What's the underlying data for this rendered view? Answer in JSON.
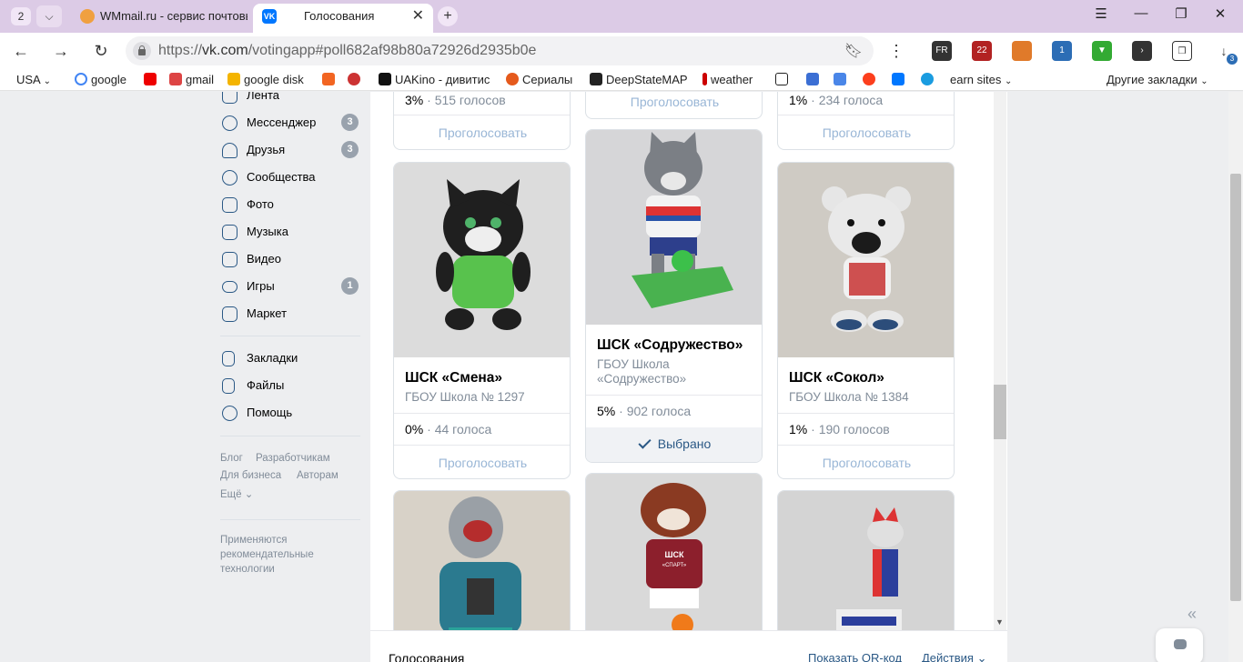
{
  "browser": {
    "tab_count": "2",
    "tabs": [
      {
        "title": "WMmail.ru - сервис почтовых",
        "active": false
      },
      {
        "title": "Голосования",
        "active": true
      }
    ],
    "url_prefix": "https://",
    "url_host": "vk.com",
    "url_path": "/votingapp#poll682af98b80a72926d2935b0e",
    "extensions": [
      {
        "icon": "globe-icon",
        "badge": "FR",
        "color": "#333333"
      },
      {
        "icon": "shield-icon",
        "badge": "22",
        "color": "#b22222"
      },
      {
        "icon": "briefcase-icon",
        "badge": "",
        "color": "#e07a2a"
      },
      {
        "icon": "puzzle-icon",
        "badge": "1",
        "color": "#2c6db5"
      },
      {
        "icon": "download-arrow-icon",
        "badge": "",
        "color": "#33aa33"
      },
      {
        "icon": "terminal-icon",
        "badge": "",
        "color": "#333333"
      },
      {
        "icon": "collections-icon",
        "badge": "",
        "color": "#333333"
      },
      {
        "icon": "downloads-icon",
        "badge": "3",
        "color": "#2c6db5"
      }
    ]
  },
  "bookmarks": [
    {
      "label": "USA",
      "icon": "chevron-down-icon"
    },
    {
      "label": "google",
      "icon": "google-icon"
    },
    {
      "label": "",
      "icon": "youtube-icon"
    },
    {
      "label": "gmail",
      "icon": "gmail-icon"
    },
    {
      "label": "google disk",
      "icon": "drive-icon"
    },
    {
      "label": "",
      "icon": "f-icon"
    },
    {
      "label": "",
      "icon": "flower-icon"
    },
    {
      "label": "UAKino - дивитис",
      "icon": "uakino-icon"
    },
    {
      "label": "Сериалы",
      "icon": "serials-icon"
    },
    {
      "label": "DeepStateMAP",
      "icon": "deepstate-icon"
    },
    {
      "label": "weather",
      "icon": "thermometer-icon"
    },
    {
      "label": "",
      "icon": "bc-icon"
    },
    {
      "label": "",
      "icon": "arrow-icon"
    },
    {
      "label": "",
      "icon": "translate-icon"
    },
    {
      "label": "",
      "icon": "yandex-icon"
    },
    {
      "label": "",
      "icon": "vk-icon"
    },
    {
      "label": "",
      "icon": "star-icon"
    },
    {
      "label": "earn sites",
      "icon": "chevron-down-icon"
    },
    {
      "label": "Другие закладки",
      "icon": "chevron-down-icon"
    }
  ],
  "sidebar": {
    "items": [
      {
        "label": "Лента",
        "badge": ""
      },
      {
        "label": "Мессенджер",
        "badge": "3"
      },
      {
        "label": "Друзья",
        "badge": "3"
      },
      {
        "label": "Сообщества",
        "badge": ""
      },
      {
        "label": "Фото",
        "badge": ""
      },
      {
        "label": "Музыка",
        "badge": ""
      },
      {
        "label": "Видео",
        "badge": ""
      },
      {
        "label": "Игры",
        "badge": "1"
      },
      {
        "label": "Маркет",
        "badge": ""
      },
      {
        "label": "Закладки",
        "badge": ""
      },
      {
        "label": "Файлы",
        "badge": ""
      },
      {
        "label": "Помощь",
        "badge": ""
      }
    ],
    "footer": {
      "blog": "Блог",
      "developers": "Разработчикам",
      "business": "Для бизнеса",
      "authors": "Авторам",
      "more": "Ещё",
      "recommend": "Применяются рекомендательные технологии"
    }
  },
  "cards_top": [
    {
      "stat_pct": "3%",
      "stat_votes": "515 голосов",
      "vote": "Проголосовать"
    },
    {
      "vote": "Проголосовать"
    },
    {
      "stat_pct": "1%",
      "stat_votes": "234 голоса",
      "vote": "Проголосовать"
    }
  ],
  "cards": [
    {
      "title": "ШСК «Смена»",
      "school": "ГБОУ Школа № 1297",
      "stat_pct": "0%",
      "stat_votes": "44 голоса",
      "vote": "Проголосовать"
    },
    {
      "title": "ШСК «Содружество»",
      "school": "ГБОУ Школа «Содружество»",
      "stat_pct": "5%",
      "stat_votes": "902 голоса",
      "chosen": "Выбрано"
    },
    {
      "title": "ШСК «Сокол»",
      "school": "ГБОУ Школа № 1384",
      "stat_pct": "1%",
      "stat_votes": "190 голосов",
      "vote": "Проголосовать"
    }
  ],
  "toy_shirt_text": "ШСК",
  "toy_shirt_text_2": "«СПАРТ»",
  "bottombar": {
    "title": "Голосования",
    "qr": "Показать QR-код",
    "actions": "Действия"
  },
  "colors": {
    "vk_blue": "#2a5885",
    "accent": "#0077ff",
    "muted": "#818c99"
  }
}
